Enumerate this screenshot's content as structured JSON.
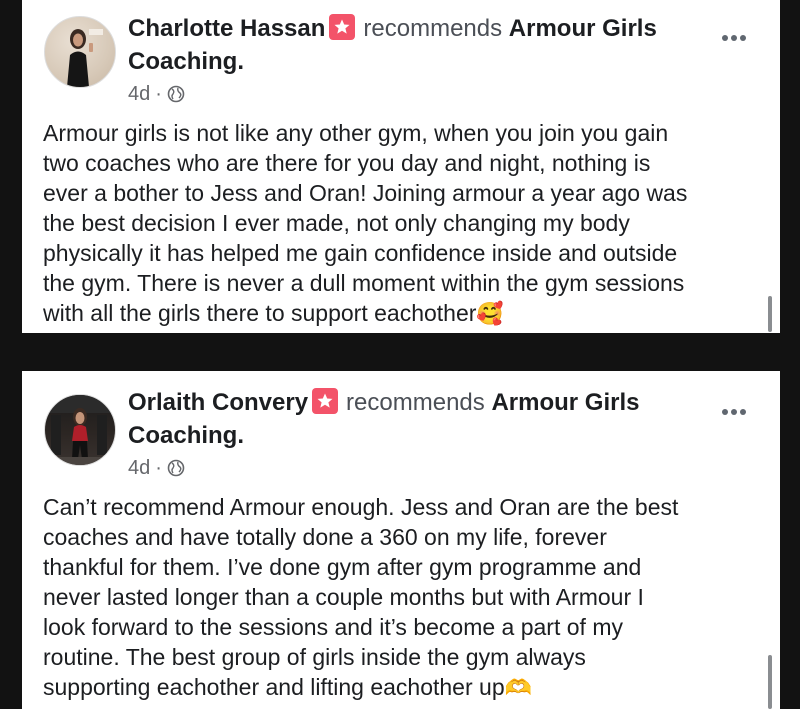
{
  "posts": [
    {
      "author": "Charlotte Hassan",
      "recommends": "recommends",
      "page": "Armour Girls Coaching.",
      "time": "4d",
      "separator": "·",
      "text": "Armour girls is not like any other gym, when you join you gain\ntwo coaches who are there for you day and night, nothing is\never a bother to Jess and Oran! Joining armour a year ago was\nthe best decision I ever made, not only changing my body\nphysically it has helped me gain confidence inside and outside\nthe gym. There is never a dull moment within the gym sessions\nwith all the girls there to support eachother",
      "emoji": "🥰"
    },
    {
      "author": "Orlaith Convery",
      "recommends": "recommends",
      "page": "Armour Girls Coaching.",
      "time": "4d",
      "separator": "·",
      "text": "Can’t recommend Armour enough. Jess and Oran are the best\ncoaches and have totally done a 360 on my life, forever\nthankful for them.  I’ve done gym after gym programme and\nnever lasted longer than a couple months but with Armour I\nlook forward to the sessions and it’s become a part of my\nroutine. The best group of girls inside the gym always\nsupporting eachother and lifting eachother up",
      "emoji": "🫶"
    }
  ],
  "icons": {
    "recommend": "star-badge-icon",
    "privacy": "globe-icon",
    "more": "more-options-icon"
  },
  "colors": {
    "badge": "#f35369",
    "background": "#121212"
  }
}
